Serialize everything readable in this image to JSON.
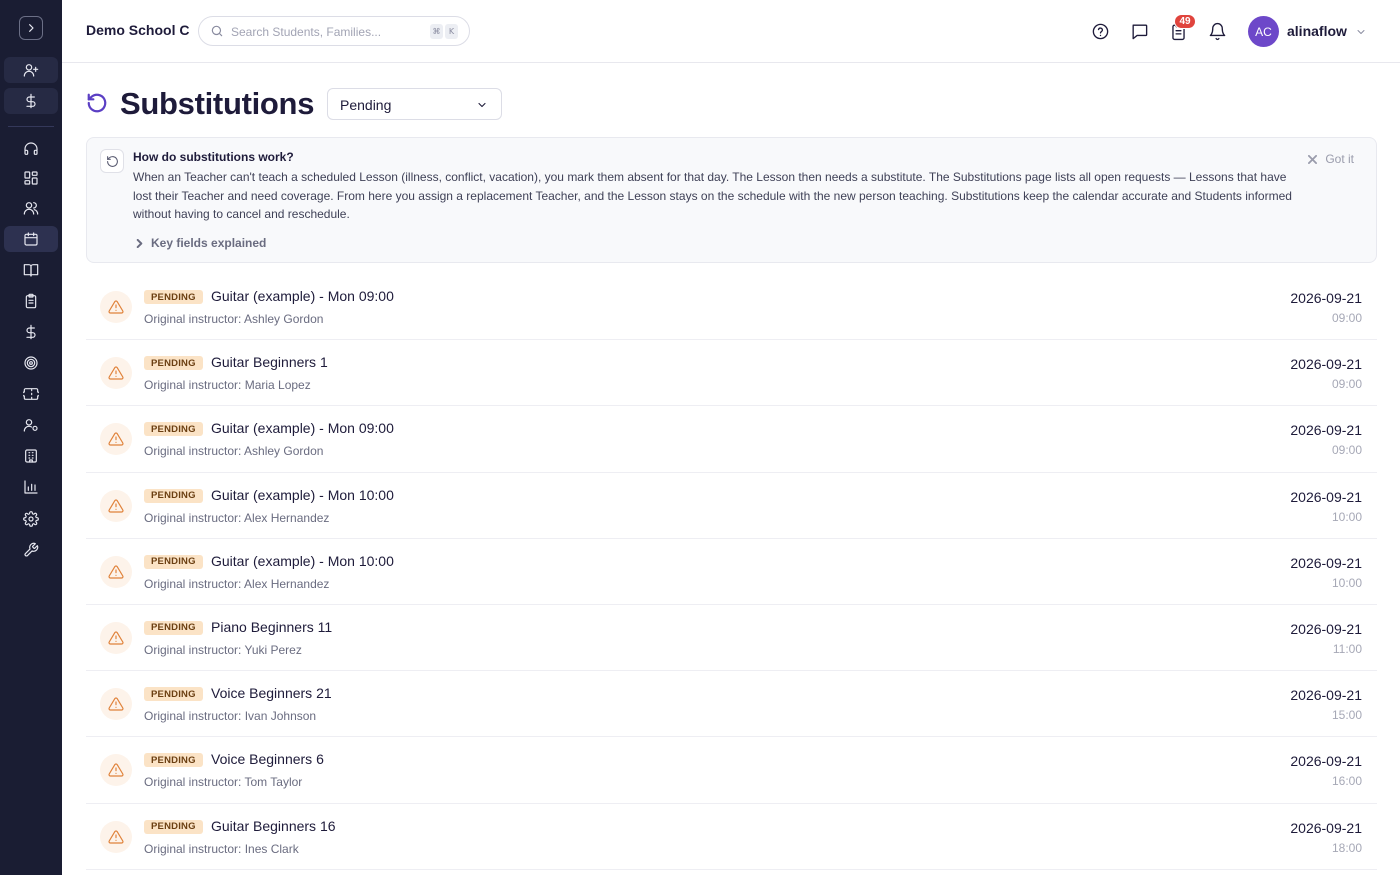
{
  "header": {
    "school_name": "Demo School C",
    "search_placeholder": "Search Students, Families...",
    "shortcut_keys": [
      "⌘",
      "K"
    ],
    "tasks_badge": "49",
    "user": {
      "initials": "AC",
      "name": "alinaflow"
    }
  },
  "sidebar": {
    "icons": [
      "add-user-icon",
      "dollar-icon",
      "headset-icon",
      "dashboard-icon",
      "users-icon",
      "calendar-icon",
      "book-icon",
      "clipboard-icon",
      "dollar-icon",
      "target-icon",
      "ticket-icon",
      "user-settings-icon",
      "building-icon",
      "bar-chart-icon",
      "gear-icon",
      "wrench-icon"
    ],
    "active": "calendar-icon"
  },
  "page": {
    "title": "Substitutions",
    "status_filter": "Pending"
  },
  "info": {
    "title": "How do substitutions work?",
    "body": "When an Teacher can't teach a scheduled Lesson (illness, conflict, vacation), you mark them absent for that day. The Lesson then needs a substitute. The Substitutions page lists all open requests — Lessons that have lost their Teacher and need coverage. From here you assign a replacement Teacher, and the Lesson stays on the schedule with the new person teaching. Substitutions keep the calendar accurate and Students informed without having to cancel and reschedule.",
    "dismiss_label": "Got it",
    "key_fields_label": "Key fields explained"
  },
  "colors": {
    "sidebar_bg": "#1a1d33",
    "accent": "#5b3fc4",
    "pending_pill_bg": "#fbe3c6",
    "warning": "#e0823a",
    "badge": "#e0443d"
  },
  "requests": [
    {
      "status": "PENDING",
      "lesson": "Guitar (example) - Mon 09:00",
      "instructor": "Original instructor: Ashley Gordon",
      "date": "2026-09-21",
      "time": "09:00"
    },
    {
      "status": "PENDING",
      "lesson": "Guitar Beginners 1",
      "instructor": "Original instructor: Maria Lopez",
      "date": "2026-09-21",
      "time": "09:00"
    },
    {
      "status": "PENDING",
      "lesson": "Guitar (example) - Mon 09:00",
      "instructor": "Original instructor: Ashley Gordon",
      "date": "2026-09-21",
      "time": "09:00"
    },
    {
      "status": "PENDING",
      "lesson": "Guitar (example) - Mon 10:00",
      "instructor": "Original instructor: Alex Hernandez",
      "date": "2026-09-21",
      "time": "10:00"
    },
    {
      "status": "PENDING",
      "lesson": "Guitar (example) - Mon 10:00",
      "instructor": "Original instructor: Alex Hernandez",
      "date": "2026-09-21",
      "time": "10:00"
    },
    {
      "status": "PENDING",
      "lesson": "Piano Beginners 11",
      "instructor": "Original instructor: Yuki Perez",
      "date": "2026-09-21",
      "time": "11:00"
    },
    {
      "status": "PENDING",
      "lesson": "Voice Beginners 21",
      "instructor": "Original instructor: Ivan Johnson",
      "date": "2026-09-21",
      "time": "15:00"
    },
    {
      "status": "PENDING",
      "lesson": "Voice Beginners 6",
      "instructor": "Original instructor: Tom Taylor",
      "date": "2026-09-21",
      "time": "16:00"
    },
    {
      "status": "PENDING",
      "lesson": "Guitar Beginners 16",
      "instructor": "Original instructor: Ines Clark",
      "date": "2026-09-21",
      "time": "18:00"
    }
  ]
}
